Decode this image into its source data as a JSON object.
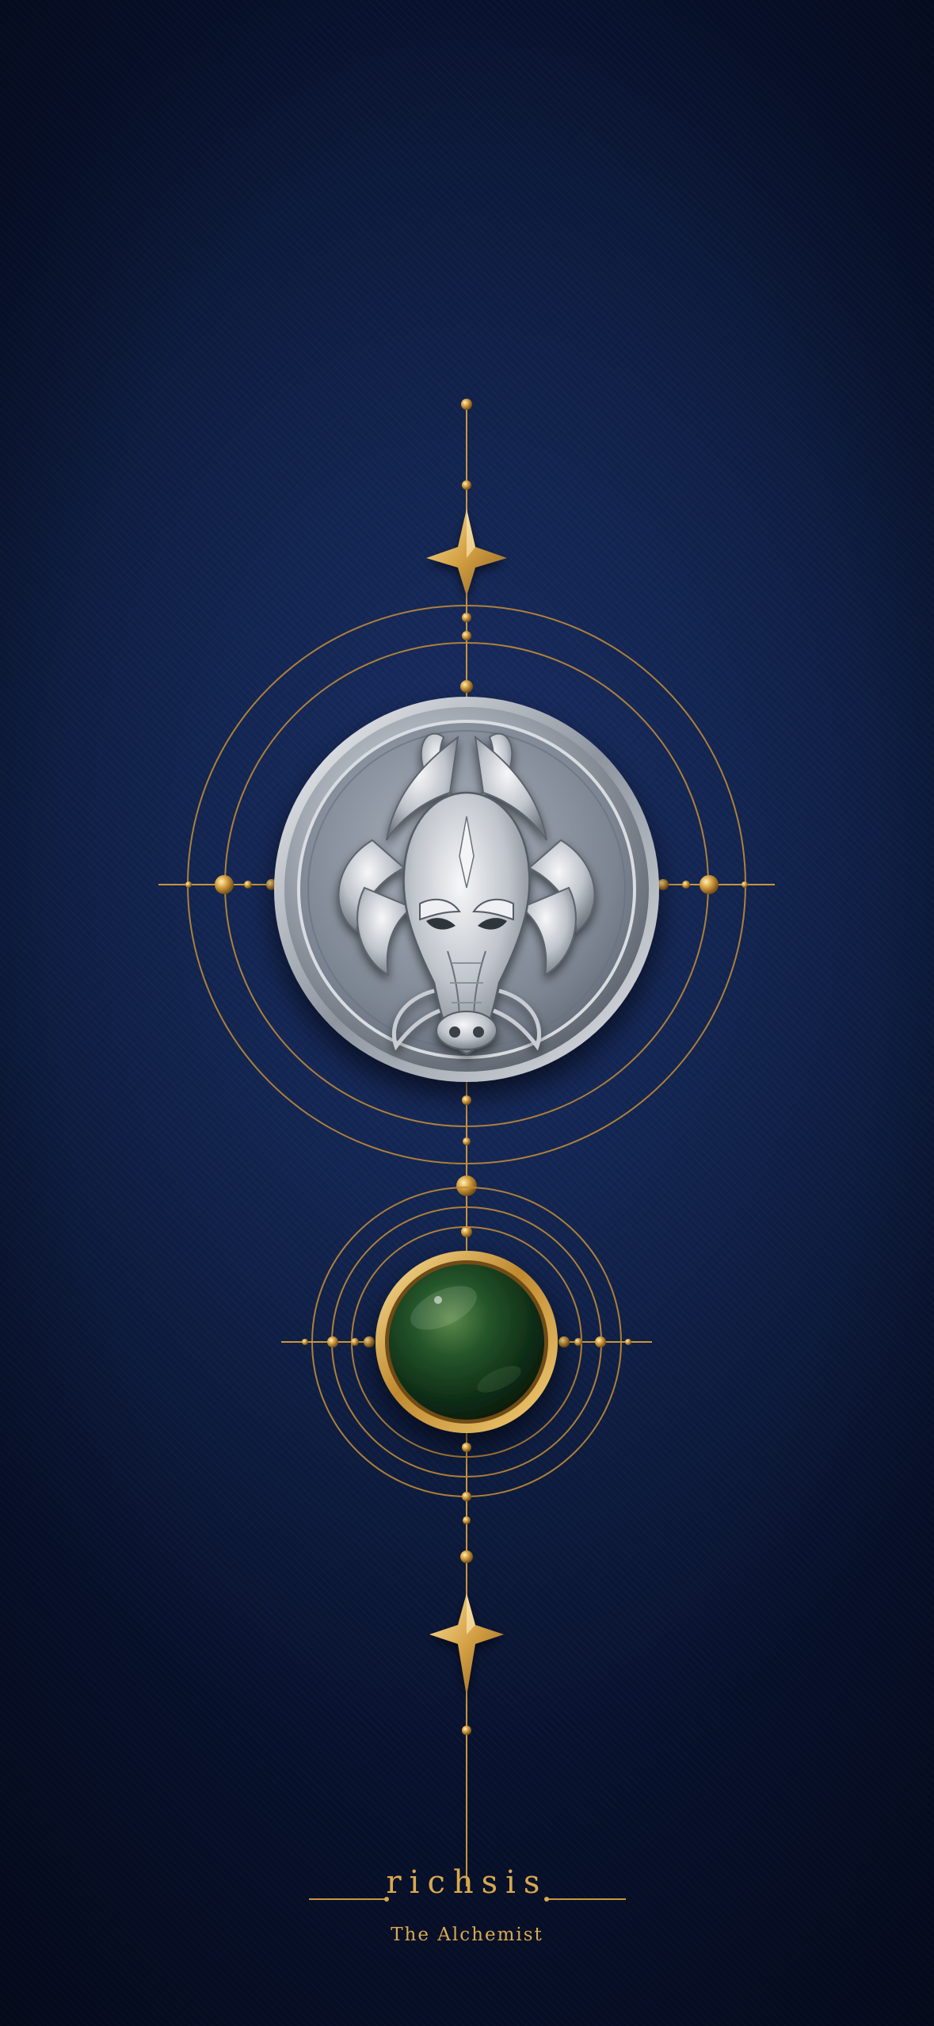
{
  "brand": {
    "name": "richsis",
    "tagline": "The Alchemist"
  },
  "colors": {
    "background": "#12244f",
    "gold": "#d4a044",
    "silver": "#b9bec6",
    "gem": "#1f4a1f"
  },
  "emblem": {
    "medallion_icon": "dragon-head-icon",
    "gem_icon": "green-gem-icon",
    "star_icon": "four-point-star-icon"
  }
}
